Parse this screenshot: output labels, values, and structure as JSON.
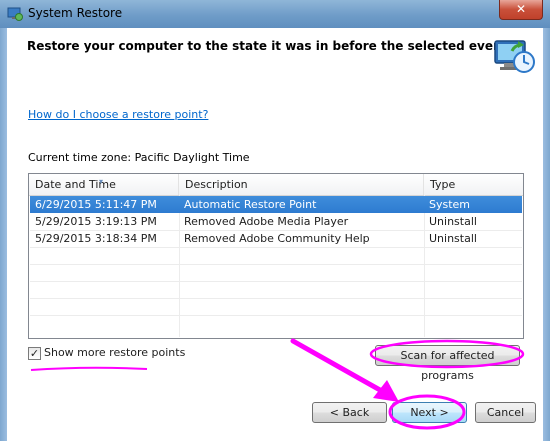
{
  "window": {
    "title": "System Restore",
    "close_glyph": "✕"
  },
  "header": {
    "heading": "Restore your computer to the state it was in before the selected event",
    "icon": "system-restore-icon"
  },
  "help_link": "How do I choose a restore point?",
  "timezone": "Current time zone: Pacific Daylight Time",
  "table": {
    "columns": [
      "Date and Time",
      "Description",
      "Type"
    ],
    "rows": [
      {
        "date": "6/29/2015 5:11:47 PM",
        "description": "Automatic Restore Point",
        "type": "System",
        "selected": true
      },
      {
        "date": "5/29/2015 3:19:13 PM",
        "description": "Removed Adobe Media Player",
        "type": "Uninstall",
        "selected": false
      },
      {
        "date": "5/29/2015 3:18:34 PM",
        "description": "Removed Adobe Community Help",
        "type": "Uninstall",
        "selected": false
      }
    ]
  },
  "show_more": {
    "label": "Show more restore points",
    "checked": true,
    "check_glyph": "✓"
  },
  "buttons": {
    "scan": "Scan for affected programs",
    "back": "< Back",
    "next": "Next >",
    "cancel": "Cancel"
  },
  "colors": {
    "annotation": "#ff00ff",
    "selection": "#3f8ddb",
    "link": "#0066cc"
  }
}
